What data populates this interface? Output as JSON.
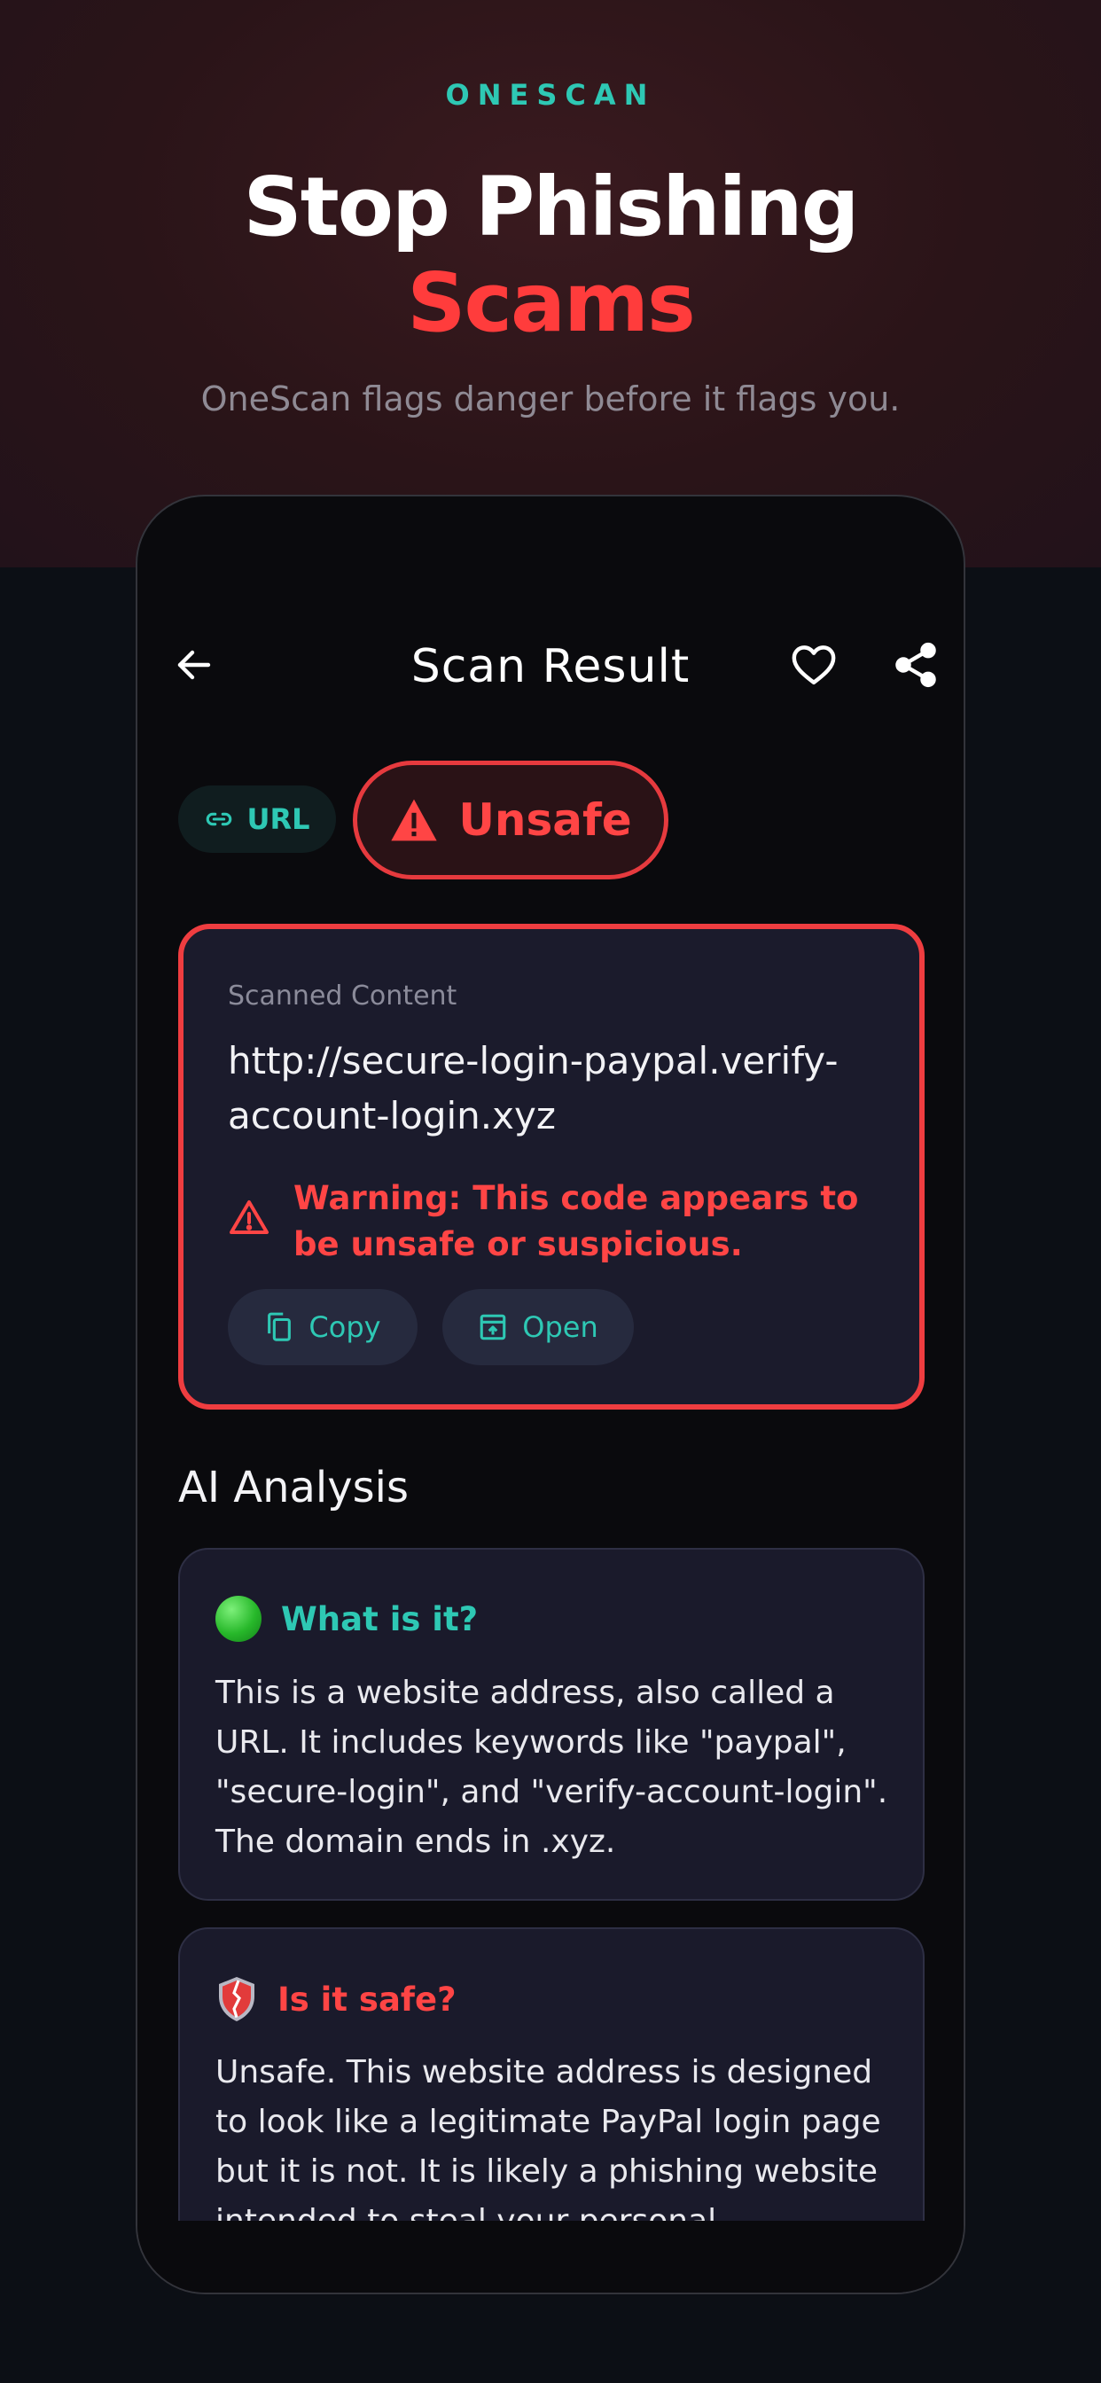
{
  "hero": {
    "brand": "ONESCAN",
    "headline_line1": "Stop Phishing",
    "headline_line2": "Scams",
    "tagline": "OneScan flags danger before it flags you."
  },
  "nav": {
    "title": "Scan Result",
    "icons": [
      "arrow-left-icon",
      "heart-icon",
      "share-icon"
    ]
  },
  "chips": {
    "type_label": "URL",
    "status_label": "Unsafe"
  },
  "scan": {
    "label": "Scanned Content",
    "content": "http://secure-login-paypal.verify-account-login.xyz",
    "warning": "Warning: This code appears to be unsafe or suspicious.",
    "copy_label": "Copy",
    "open_label": "Open"
  },
  "analysis": {
    "title": "AI Analysis",
    "cards": [
      {
        "title": "What is it?",
        "body": "This is a website address, also called a URL. It includes keywords like \"paypal\", \"secure-login\", and \"verify-account-login\". The domain ends in .xyz."
      },
      {
        "title": "Is it safe?",
        "body": "Unsafe. This website address is designed to look like a legitimate PayPal login page but it is not. It is likely a phishing website intended to steal your personal"
      }
    ]
  },
  "colors": {
    "accent_teal": "#2ec8b4",
    "danger_red": "#ff4545",
    "card_bg": "#1b1b2c"
  }
}
